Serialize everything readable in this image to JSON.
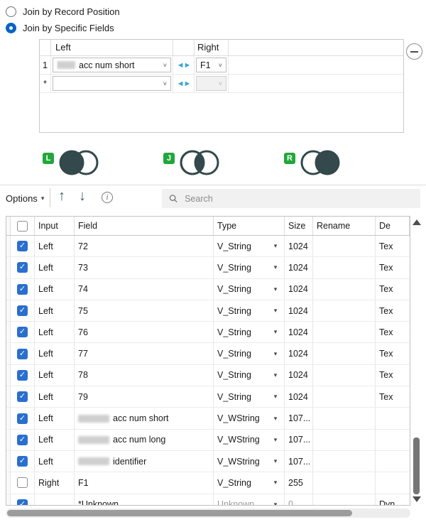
{
  "radios": [
    {
      "label": "Join by Record Position",
      "selected": false
    },
    {
      "label": "Join by Specific Fields",
      "selected": true
    }
  ],
  "join": {
    "left_header": "Left",
    "right_header": "Right",
    "rows": [
      {
        "index": "1",
        "left_value": "acc num short",
        "left_redacted": true,
        "right_value": "F1"
      },
      {
        "index": "*",
        "left_value": "",
        "left_redacted": false,
        "right_value": ""
      }
    ]
  },
  "venn": {
    "left_label": "L",
    "join_label": "J",
    "right_label": "R"
  },
  "toolbar": {
    "options_label": "Options",
    "search_placeholder": "Search"
  },
  "grid": {
    "headers": [
      "Input",
      "Field",
      "Type",
      "Size",
      "Rename",
      "De"
    ],
    "rows": [
      {
        "checked": true,
        "input": "Left",
        "field": "72",
        "redacted": false,
        "type": "V_String",
        "size": "1024",
        "rename": "",
        "desc": "Tex",
        "muted": false
      },
      {
        "checked": true,
        "input": "Left",
        "field": "73",
        "redacted": false,
        "type": "V_String",
        "size": "1024",
        "rename": "",
        "desc": "Tex",
        "muted": false
      },
      {
        "checked": true,
        "input": "Left",
        "field": "74",
        "redacted": false,
        "type": "V_String",
        "size": "1024",
        "rename": "",
        "desc": "Tex",
        "muted": false
      },
      {
        "checked": true,
        "input": "Left",
        "field": "75",
        "redacted": false,
        "type": "V_String",
        "size": "1024",
        "rename": "",
        "desc": "Tex",
        "muted": false
      },
      {
        "checked": true,
        "input": "Left",
        "field": "76",
        "redacted": false,
        "type": "V_String",
        "size": "1024",
        "rename": "",
        "desc": "Tex",
        "muted": false
      },
      {
        "checked": true,
        "input": "Left",
        "field": "77",
        "redacted": false,
        "type": "V_String",
        "size": "1024",
        "rename": "",
        "desc": "Tex",
        "muted": false
      },
      {
        "checked": true,
        "input": "Left",
        "field": "78",
        "redacted": false,
        "type": "V_String",
        "size": "1024",
        "rename": "",
        "desc": "Tex",
        "muted": false
      },
      {
        "checked": true,
        "input": "Left",
        "field": "79",
        "redacted": false,
        "type": "V_String",
        "size": "1024",
        "rename": "",
        "desc": "Tex",
        "muted": false
      },
      {
        "checked": true,
        "input": "Left",
        "field": "acc num short",
        "redacted": true,
        "type": "V_WString",
        "size": "107...",
        "rename": "",
        "desc": "",
        "muted": false
      },
      {
        "checked": true,
        "input": "Left",
        "field": "acc num long",
        "redacted": true,
        "type": "V_WString",
        "size": "107...",
        "rename": "",
        "desc": "",
        "muted": false
      },
      {
        "checked": true,
        "input": "Left",
        "field": "identifier",
        "redacted": true,
        "type": "V_WString",
        "size": "107...",
        "rename": "",
        "desc": "",
        "muted": false
      },
      {
        "checked": false,
        "input": "Right",
        "field": "F1",
        "redacted": false,
        "type": "V_String",
        "size": "255",
        "rename": "",
        "desc": "",
        "muted": false
      },
      {
        "checked": true,
        "input": "",
        "field": "*Unknown",
        "redacted": false,
        "type": "Unknown",
        "size": "0",
        "rename": "",
        "desc": "Dyn",
        "muted": true
      }
    ]
  },
  "colors": {
    "accent_blue": "#2a6fce",
    "radio_blue": "#0b63c5",
    "venn_dark": "#33494b",
    "anchor_green": "#23a63c",
    "swap_arrow_cyan": "#3ba7cf"
  }
}
